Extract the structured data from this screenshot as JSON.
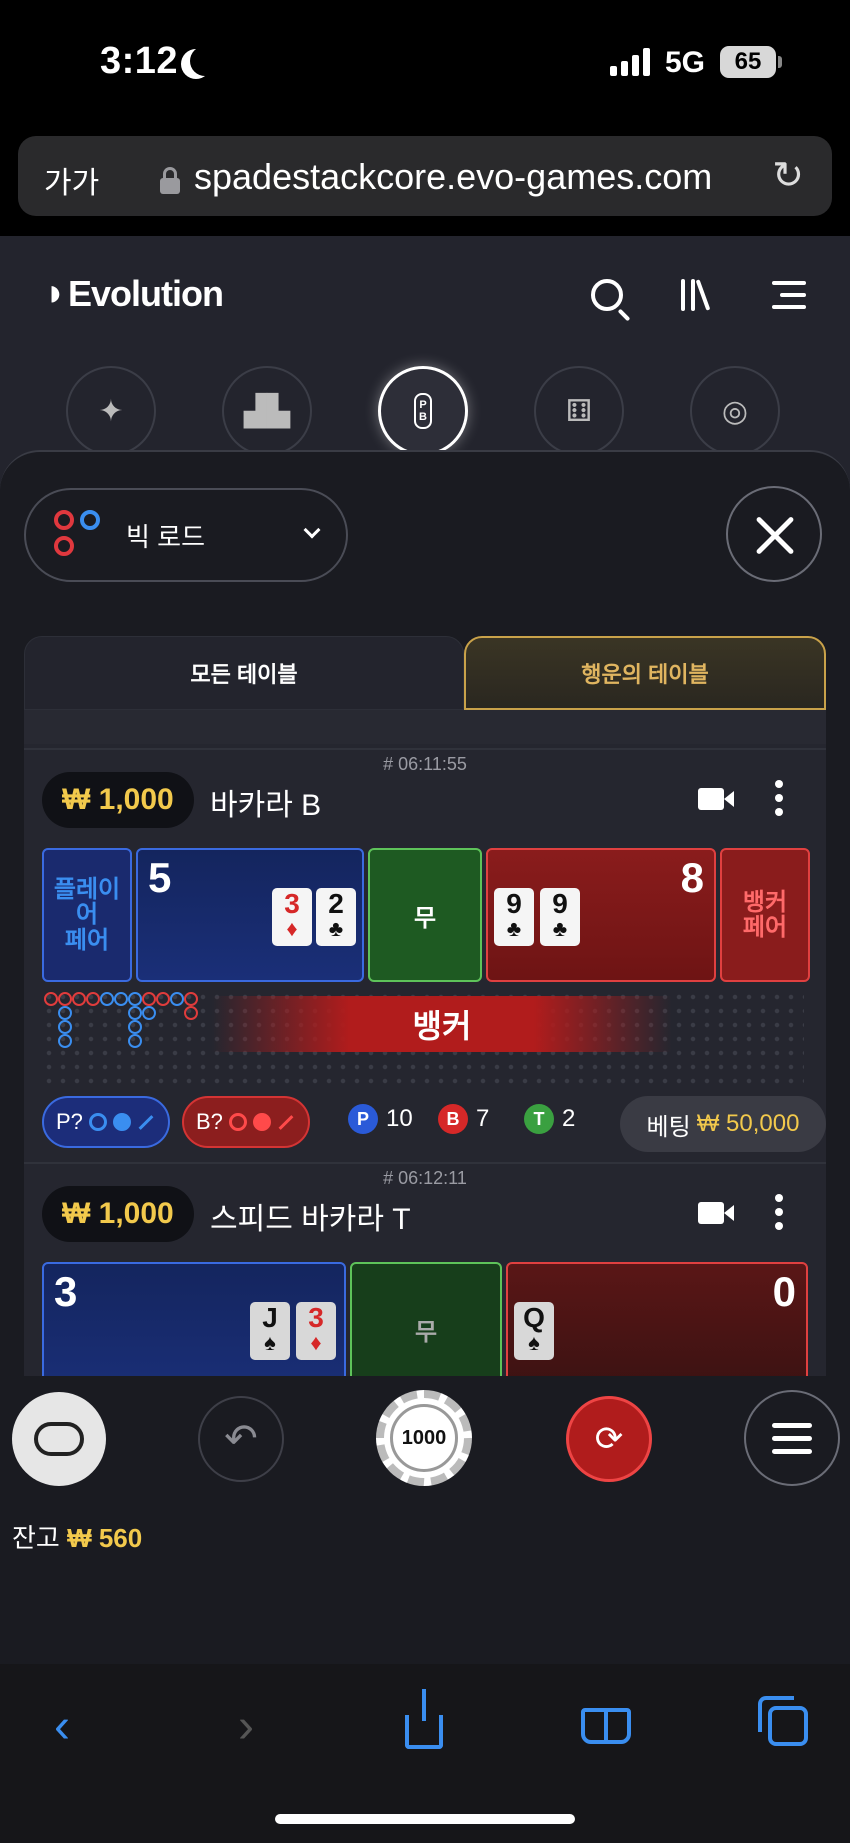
{
  "status_bar": {
    "time": "3:12",
    "network": "5G",
    "battery": "65"
  },
  "browser": {
    "text_size_label": "가가",
    "url": "spadestackcore.evo-games.com"
  },
  "header": {
    "logo": "Evolution"
  },
  "road_selector": {
    "label": "빅 로드"
  },
  "tabs": {
    "all": "모든 테이블",
    "lucky": "행운의 테이블"
  },
  "tables": [
    {
      "time": "# 06:11:55",
      "min_bet": "₩ 1,000",
      "name": "바카라 B",
      "player_pair_label": "플레이\n어\n페어",
      "player_score": "5",
      "player_cards": [
        {
          "rank": "3",
          "suit": "♦",
          "red": true
        },
        {
          "rank": "2",
          "suit": "♣",
          "red": false
        }
      ],
      "tie_label": "무",
      "banker_cards": [
        {
          "rank": "9",
          "suit": "♣",
          "red": false
        },
        {
          "rank": "9",
          "suit": "♣",
          "red": false
        }
      ],
      "banker_score": "8",
      "banker_pair_label": "뱅커\n페어",
      "winner_label": "뱅커",
      "p_predict": "P?",
      "b_predict": "B?",
      "player_count": "10",
      "banker_count": "7",
      "tie_count": "2",
      "badge_p": "P",
      "badge_b": "B",
      "badge_t": "T",
      "total_bet_label": "베팅",
      "total_bet_value": "₩ 50,000"
    },
    {
      "time": "# 06:12:11",
      "min_bet": "₩ 1,000",
      "name": "스피드 바카라 T",
      "player_score": "3",
      "player_cards": [
        {
          "rank": "J",
          "suit": "♠",
          "red": false
        },
        {
          "rank": "3",
          "suit": "♦",
          "red": true
        }
      ],
      "tie_label": "무",
      "banker_cards": [
        {
          "rank": "Q",
          "suit": "♠",
          "red": false
        }
      ],
      "banker_score": "0"
    }
  ],
  "controls": {
    "chip_value": "1000"
  },
  "balance": {
    "label": "잔고",
    "value": "₩ 560"
  },
  "colors": {
    "gold": "#f2c94c",
    "player_blue": "#3a6ae0",
    "banker_red": "#e04040",
    "tie_green": "#5ec35a"
  }
}
